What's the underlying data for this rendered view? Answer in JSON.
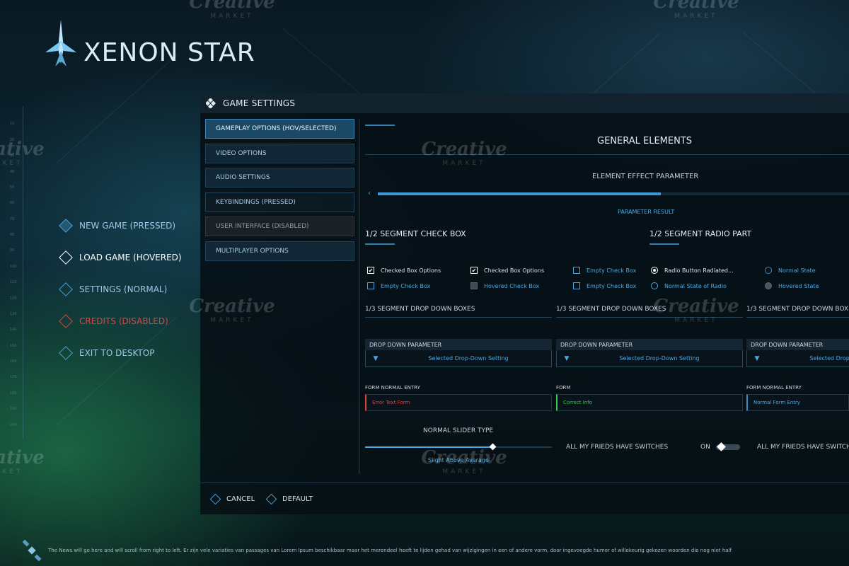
{
  "game": {
    "title": "XENON STAR"
  },
  "main_menu": {
    "items": [
      {
        "label": "NEW GAME (PRESSED)",
        "state": "pressed"
      },
      {
        "label": "LOAD GAME (HOVERED)",
        "state": "hovered"
      },
      {
        "label": "SETTINGS (NORMAL)",
        "state": "normal"
      },
      {
        "label": "CREDITS (DISABLED)",
        "state": "disabled"
      },
      {
        "label": "EXIT TO DESKTOP",
        "state": "normal"
      }
    ]
  },
  "ruler_ticks": [
    "10",
    "20",
    "30",
    "40",
    "50",
    "60",
    "70",
    "80",
    "90",
    "100",
    "110",
    "120",
    "130",
    "140",
    "150",
    "160",
    "170",
    "180",
    "190",
    "200"
  ],
  "settings": {
    "title": "GAME SETTINGS",
    "tabs": [
      {
        "label": "GAMEPLAY OPTIONS (HOV/SELECTED)",
        "state": "selected"
      },
      {
        "label": "VIDEO OPTIONS",
        "state": "normal"
      },
      {
        "label": "AUDIO SETTINGS",
        "state": "normal"
      },
      {
        "label": "KEYBINDINGS (PRESSED)",
        "state": "pressed"
      },
      {
        "label": "USER INTERFACE (DISABLED)",
        "state": "disabled"
      },
      {
        "label": "MULTIPLAYER OPTIONS",
        "state": "normal"
      }
    ],
    "general": {
      "title": "GENERAL ELEMENTS",
      "effect_param": "ELEMENT EFFECT PARAMETER",
      "param_result": "PARAMETER RESULT",
      "progress_fraction": 0.6
    },
    "checkbox_section": {
      "title": "1/2 SEGMENT CHECK BOX",
      "items": [
        {
          "label": "Checked Box Options",
          "checked": true
        },
        {
          "label": "Checked Box Options",
          "checked": true
        },
        {
          "label": "Empty Check Box",
          "checked": false
        },
        {
          "label": "Empty Check Box",
          "checked": false
        },
        {
          "label": "Hovered Check Box",
          "checked": false
        },
        {
          "label": "Empty Check Box",
          "checked": false
        }
      ]
    },
    "radio_section": {
      "title": "1/2 SEGMENT RADIO PART",
      "items": [
        {
          "label": "Radio Button Radiated...",
          "checked": true
        },
        {
          "label": "Normal State of Radio",
          "checked": false
        },
        {
          "label": "Normal State",
          "checked": false
        },
        {
          "label": "Hovered State",
          "checked": false
        }
      ]
    },
    "dropdowns": [
      {
        "section": "1/3 SEGMENT DROP DOWN BOXES",
        "label": "DROP DOWN PARAMETER",
        "value": "Selected Drop-Down Setting"
      },
      {
        "section": "1/3 SEGMENT DROP DOWN BOXES",
        "label": "DROP DOWN PARAMETER",
        "value": "Selected Drop-Down Setting"
      },
      {
        "section": "1/3 SEGMENT DROP DOWN BOX",
        "label": "DROP DOWN PARAMETER",
        "value": "Selected Drop-Down Setting"
      }
    ],
    "forms": [
      {
        "label": "FORM NORMAL ENTRY",
        "value": "Error Text Form"
      },
      {
        "label": "FORM",
        "value": "Correct Info"
      },
      {
        "label": "FORM NORMAL ENTRY",
        "value": "Normal Form Entry"
      }
    ],
    "slider": {
      "title": "NORMAL SLIDER TYPE",
      "value_label": "Slight Above Avarage",
      "fraction": 0.68
    },
    "switches": [
      {
        "label": "ALL MY FRIEDS HAVE SWITCHES",
        "state": "ON"
      },
      {
        "label": "ALL MY FRIEDS HAVE SWITCHES"
      }
    ],
    "footer": {
      "cancel": "CANCEL",
      "default": "DEFAULT"
    }
  },
  "news": {
    "text": "The News will go here and will scroll from right to left. Er zijn vele variaties van passages van Lorem Ipsum beschikbaar maar het merendeel heeft te lijden gehad van wijzigingen in een of andere vorm, door ingevoegde humor of willekeurig gekozen woorden die nog niet half"
  },
  "watermark": {
    "brand": "Creative",
    "sub": "MARKET"
  },
  "colors": {
    "accent": "#4aa8e0",
    "error": "#e0423a",
    "success": "#36c84a",
    "panel_bg": "#060e14"
  }
}
